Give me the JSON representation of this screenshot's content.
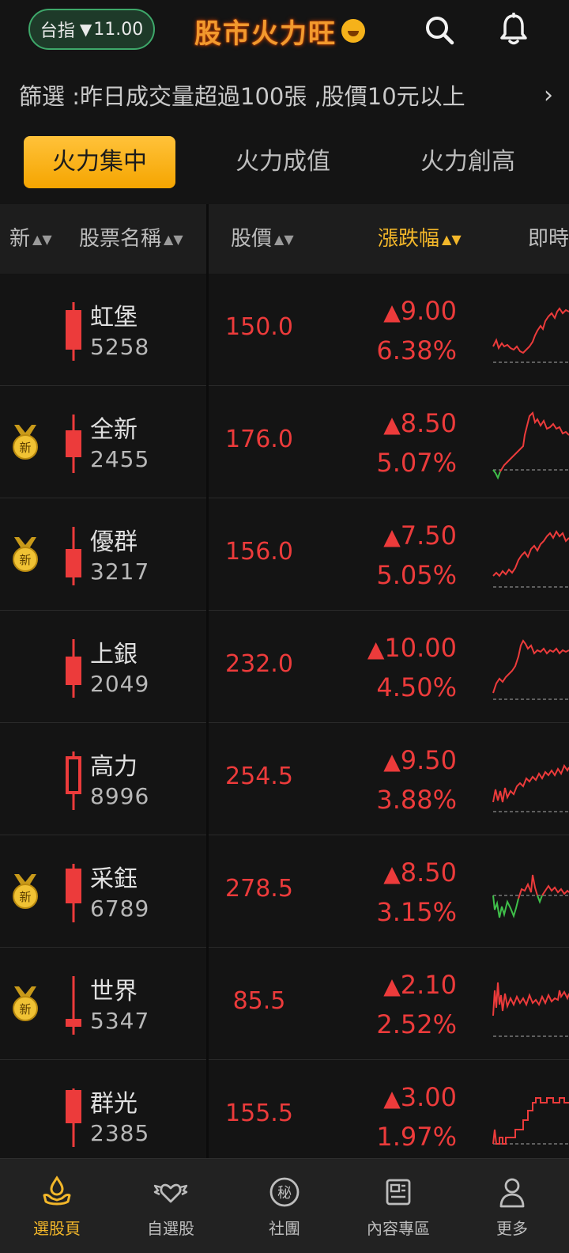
{
  "header": {
    "index_label": "台指",
    "index_arrow": "▼",
    "index_value": "11.00",
    "app_title": "股市火力旺",
    "icons": [
      "search-icon",
      "bell-icon"
    ]
  },
  "filter": {
    "text": "篩選 :昨日成交量超過100張 ,股價10元以上",
    "chevron": "›"
  },
  "tabs": [
    {
      "label": "火力集中",
      "active": true
    },
    {
      "label": "火力成值",
      "active": false
    },
    {
      "label": "火力創高",
      "active": false
    }
  ],
  "columns": {
    "new": "新",
    "name": "股票名稱",
    "price": "股價",
    "change": "漲跌幅",
    "realtime": "即時"
  },
  "sort_arrow": "▲▼",
  "medal_text": "新",
  "colors": {
    "up": "#ec3b3b",
    "down": "#3fbf4a",
    "accent": "#f5b21a",
    "background": "#141414"
  },
  "stocks": [
    {
      "name": "虹堡",
      "code": "5258",
      "price": "150.0",
      "change": "9.00",
      "pct": "6.38%",
      "is_new": false
    },
    {
      "name": "全新",
      "code": "2455",
      "price": "176.0",
      "change": "8.50",
      "pct": "5.07%",
      "is_new": true
    },
    {
      "name": "優群",
      "code": "3217",
      "price": "156.0",
      "change": "7.50",
      "pct": "5.05%",
      "is_new": true
    },
    {
      "name": "上銀",
      "code": "2049",
      "price": "232.0",
      "change": "10.00",
      "pct": "4.50%",
      "is_new": false
    },
    {
      "name": "高力",
      "code": "8996",
      "price": "254.5",
      "change": "9.50",
      "pct": "3.88%",
      "is_new": false
    },
    {
      "name": "采鈺",
      "code": "6789",
      "price": "278.5",
      "change": "8.50",
      "pct": "3.15%",
      "is_new": true
    },
    {
      "name": "世界",
      "code": "5347",
      "price": "85.5",
      "change": "2.10",
      "pct": "2.52%",
      "is_new": true
    },
    {
      "name": "群光",
      "code": "2385",
      "price": "155.5",
      "change": "3.00",
      "pct": "1.97%",
      "is_new": false
    }
  ],
  "change_arrow": "▲",
  "bottom_nav": [
    {
      "label": "選股頁",
      "icon": "stock-pick-icon",
      "active": true
    },
    {
      "label": "自選股",
      "icon": "winged-heart-icon",
      "active": false
    },
    {
      "label": "社團",
      "icon": "secret-badge-icon",
      "active": false
    },
    {
      "label": "內容專區",
      "icon": "newspaper-icon",
      "active": false
    },
    {
      "label": "更多",
      "icon": "person-icon",
      "active": false
    }
  ],
  "secret_char": "秘"
}
